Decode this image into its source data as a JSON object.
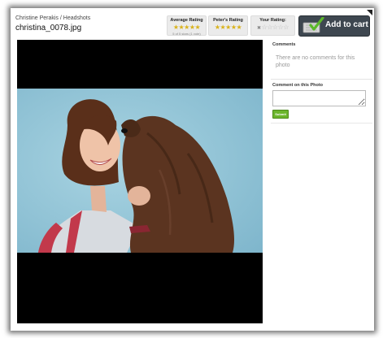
{
  "breadcrumb": {
    "parent": "Christine Perakis",
    "separator": "/",
    "current": "Headshots"
  },
  "photo": {
    "title": "christina_0078.jpg"
  },
  "ratings": {
    "average": {
      "label": "Average Rating",
      "stars": 5,
      "votes_text": "5 of 5 stars (1 vote)"
    },
    "owner": {
      "label": "Peter's Rating",
      "stars": 5
    },
    "user": {
      "label": "Your Rating:",
      "stars": 0
    }
  },
  "cart": {
    "label": "Add to cart",
    "icon": "cart-check-icon"
  },
  "comments": {
    "heading": "Comments",
    "empty_text": "There are no comments for this photo",
    "form_heading": "Comment on this Photo",
    "submit_label": "Submit"
  },
  "colors": {
    "accent_green": "#6bb52c",
    "cart_bg": "#3e4750",
    "star_gold": "#d9b21a"
  }
}
